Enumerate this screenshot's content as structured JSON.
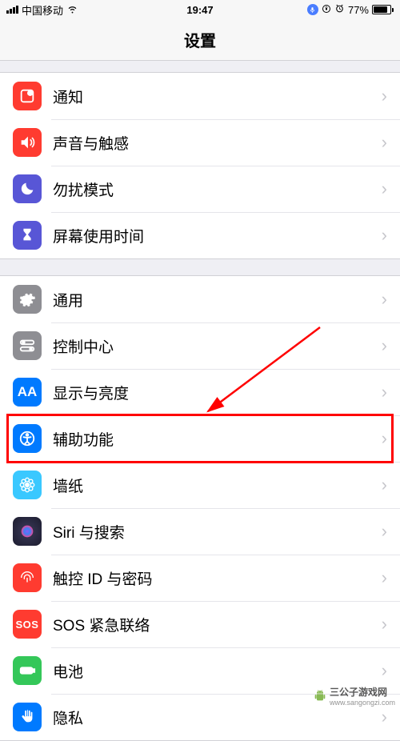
{
  "status": {
    "carrier": "中国移动",
    "time": "19:47",
    "battery_pct": "77%"
  },
  "nav": {
    "title": "设置"
  },
  "groups": [
    {
      "rows": [
        {
          "id": "notifications",
          "label": "通知",
          "icon": "notifications-icon",
          "bg": "bg-red"
        },
        {
          "id": "sounds",
          "label": "声音与触感",
          "icon": "speaker-icon",
          "bg": "bg-red"
        },
        {
          "id": "dnd",
          "label": "勿扰模式",
          "icon": "moon-icon",
          "bg": "bg-purple"
        },
        {
          "id": "screentime",
          "label": "屏幕使用时间",
          "icon": "hourglass-icon",
          "bg": "bg-purple"
        }
      ]
    },
    {
      "rows": [
        {
          "id": "general",
          "label": "通用",
          "icon": "gear-icon",
          "bg": "bg-gray"
        },
        {
          "id": "control-center",
          "label": "控制中心",
          "icon": "switches-icon",
          "bg": "bg-gray"
        },
        {
          "id": "display",
          "label": "显示与亮度",
          "icon": "aa-icon",
          "bg": "bg-blue"
        },
        {
          "id": "accessibility",
          "label": "辅助功能",
          "icon": "accessibility-icon",
          "bg": "bg-blue",
          "highlighted": true
        },
        {
          "id": "wallpaper",
          "label": "墙纸",
          "icon": "flower-icon",
          "bg": "bg-cyan"
        },
        {
          "id": "siri",
          "label": "Siri 与搜索",
          "icon": "siri-icon",
          "bg": "bg-siri"
        },
        {
          "id": "touchid",
          "label": "触控 ID 与密码",
          "icon": "fingerprint-icon",
          "bg": "bg-red"
        },
        {
          "id": "sos",
          "label": "SOS 紧急联络",
          "icon": "sos-icon",
          "bg": "bg-sos"
        },
        {
          "id": "battery",
          "label": "电池",
          "icon": "battery-icon",
          "bg": "bg-green"
        },
        {
          "id": "privacy",
          "label": "隐私",
          "icon": "hand-icon",
          "bg": "bg-blue"
        }
      ]
    }
  ],
  "annotation": {
    "highlight_row": "accessibility",
    "arrow_color": "#ff0000"
  },
  "watermark": {
    "text": "三公子游戏网",
    "url": "www.sangongzi.com"
  }
}
